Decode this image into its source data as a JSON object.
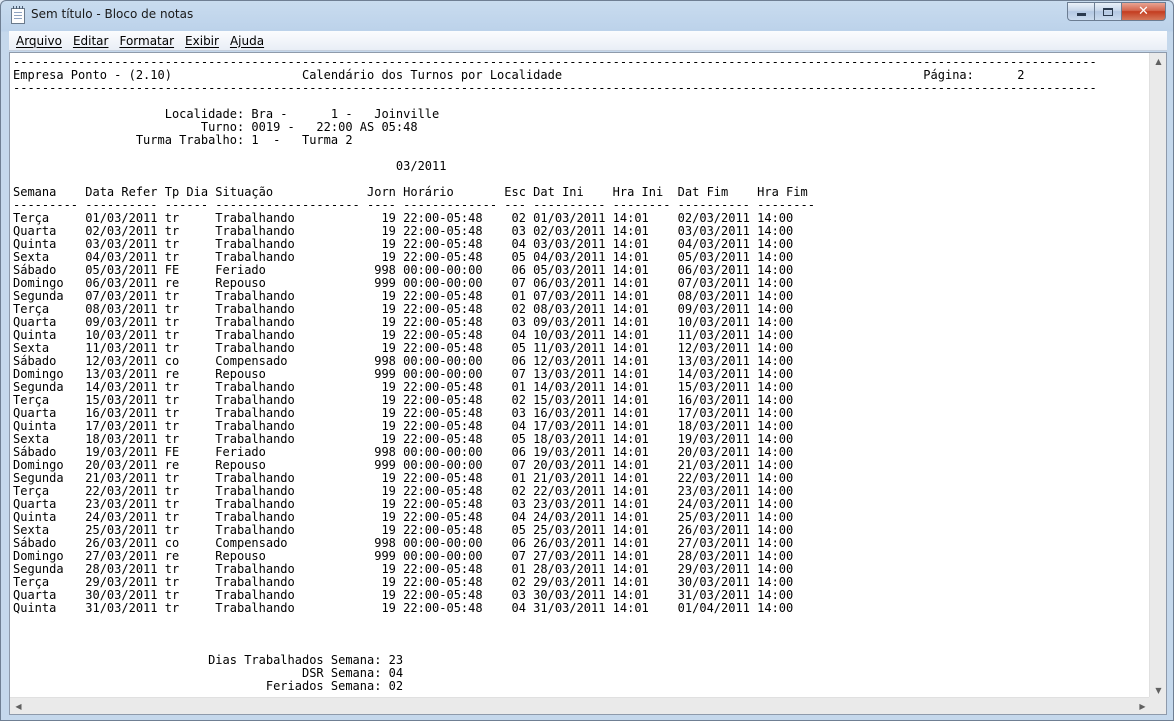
{
  "window": {
    "title": "Sem título - Bloco de notas",
    "icon": "notepad-icon",
    "controls": {
      "minimize_icon": "minimize-icon",
      "maximize_icon": "maximize-icon",
      "close_icon": "close-icon",
      "close_glyph": "✕"
    }
  },
  "menu": {
    "file": "Arquivo",
    "edit": "Editar",
    "format": "Formatar",
    "view": "Exibir",
    "help": "Ajuda"
  },
  "document": {
    "lines": [
      "------------------------------------------------------------------------------------------------------------------------------------------------------",
      "Empresa Ponto - (2.10)                  Calendário dos Turnos por Localidade                                                  Página:      2",
      "------------------------------------------------------------------------------------------------------------------------------------------------------",
      "",
      "                     Localidade: Bra -      1 -   Joinville",
      "                          Turno: 0019 -   22:00 AS 05:48",
      "                 Turma Trabalho: 1  -   Turma 2",
      "",
      "                                                     03/2011",
      "",
      "Semana    Data Refer Tp Dia Situação             Jorn Horário       Esc Dat Ini    Hra Ini  Dat Fim    Hra Fim",
      "--------- ---------- ------ -------------------- ---- ------------- --- ---------- -------- ---------- --------",
      "Terça     01/03/2011 tr     Trabalhando            19 22:00-05:48    02 01/03/2011 14:01    02/03/2011 14:00",
      "Quarta    02/03/2011 tr     Trabalhando            19 22:00-05:48    03 02/03/2011 14:01    03/03/2011 14:00",
      "Quinta    03/03/2011 tr     Trabalhando            19 22:00-05:48    04 03/03/2011 14:01    04/03/2011 14:00",
      "Sexta     04/03/2011 tr     Trabalhando            19 22:00-05:48    05 04/03/2011 14:01    05/03/2011 14:00",
      "Sábado    05/03/2011 FE     Feriado               998 00:00-00:00    06 05/03/2011 14:01    06/03/2011 14:00",
      "Domingo   06/03/2011 re     Repouso               999 00:00-00:00    07 06/03/2011 14:01    07/03/2011 14:00",
      "Segunda   07/03/2011 tr     Trabalhando            19 22:00-05:48    01 07/03/2011 14:01    08/03/2011 14:00",
      "Terça     08/03/2011 tr     Trabalhando            19 22:00-05:48    02 08/03/2011 14:01    09/03/2011 14:00",
      "Quarta    09/03/2011 tr     Trabalhando            19 22:00-05:48    03 09/03/2011 14:01    10/03/2011 14:00",
      "Quinta    10/03/2011 tr     Trabalhando            19 22:00-05:48    04 10/03/2011 14:01    11/03/2011 14:00",
      "Sexta     11/03/2011 tr     Trabalhando            19 22:00-05:48    05 11/03/2011 14:01    12/03/2011 14:00",
      "Sábado    12/03/2011 co     Compensado            998 00:00-00:00    06 12/03/2011 14:01    13/03/2011 14:00",
      "Domingo   13/03/2011 re     Repouso               999 00:00-00:00    07 13/03/2011 14:01    14/03/2011 14:00",
      "Segunda   14/03/2011 tr     Trabalhando            19 22:00-05:48    01 14/03/2011 14:01    15/03/2011 14:00",
      "Terça     15/03/2011 tr     Trabalhando            19 22:00-05:48    02 15/03/2011 14:01    16/03/2011 14:00",
      "Quarta    16/03/2011 tr     Trabalhando            19 22:00-05:48    03 16/03/2011 14:01    17/03/2011 14:00",
      "Quinta    17/03/2011 tr     Trabalhando            19 22:00-05:48    04 17/03/2011 14:01    18/03/2011 14:00",
      "Sexta     18/03/2011 tr     Trabalhando            19 22:00-05:48    05 18/03/2011 14:01    19/03/2011 14:00",
      "Sábado    19/03/2011 FE     Feriado               998 00:00-00:00    06 19/03/2011 14:01    20/03/2011 14:00",
      "Domingo   20/03/2011 re     Repouso               999 00:00-00:00    07 20/03/2011 14:01    21/03/2011 14:00",
      "Segunda   21/03/2011 tr     Trabalhando            19 22:00-05:48    01 21/03/2011 14:01    22/03/2011 14:00",
      "Terça     22/03/2011 tr     Trabalhando            19 22:00-05:48    02 22/03/2011 14:01    23/03/2011 14:00",
      "Quarta    23/03/2011 tr     Trabalhando            19 22:00-05:48    03 23/03/2011 14:01    24/03/2011 14:00",
      "Quinta    24/03/2011 tr     Trabalhando            19 22:00-05:48    04 24/03/2011 14:01    25/03/2011 14:00",
      "Sexta     25/03/2011 tr     Trabalhando            19 22:00-05:48    05 25/03/2011 14:01    26/03/2011 14:00",
      "Sábado    26/03/2011 co     Compensado            998 00:00-00:00    06 26/03/2011 14:01    27/03/2011 14:00",
      "Domingo   27/03/2011 re     Repouso               999 00:00-00:00    07 27/03/2011 14:01    28/03/2011 14:00",
      "Segunda   28/03/2011 tr     Trabalhando            19 22:00-05:48    01 28/03/2011 14:01    29/03/2011 14:00",
      "Terça     29/03/2011 tr     Trabalhando            19 22:00-05:48    02 29/03/2011 14:01    30/03/2011 14:00",
      "Quarta    30/03/2011 tr     Trabalhando            19 22:00-05:48    03 30/03/2011 14:01    31/03/2011 14:00",
      "Quinta    31/03/2011 tr     Trabalhando            19 22:00-05:48    04 31/03/2011 14:01    01/04/2011 14:00",
      "",
      "",
      "",
      "                           Dias Trabalhados Semana: 23",
      "                                        DSR Semana: 04",
      "                                   Feriados Semana: 02"
    ]
  },
  "colors": {
    "frame": "#c2d6ec",
    "close_button": "#c94a2e",
    "text": "#000000",
    "editor_background": "#ffffff"
  }
}
